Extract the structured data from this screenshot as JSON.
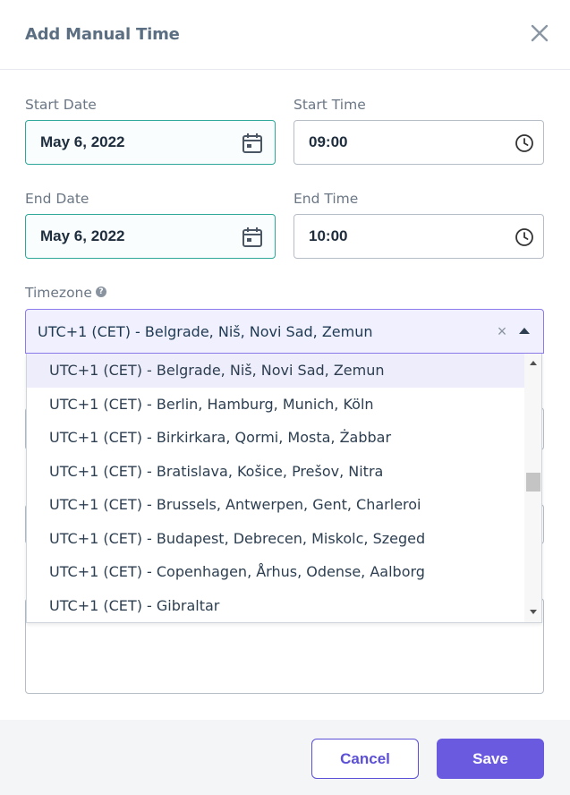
{
  "modal": {
    "title": "Add Manual Time",
    "close_icon": "close-icon"
  },
  "form": {
    "start_date": {
      "label": "Start Date",
      "value": "May 6, 2022",
      "icon": "calendar-icon"
    },
    "start_time": {
      "label": "Start Time",
      "value": "09:00",
      "icon": "clock-icon"
    },
    "end_date": {
      "label": "End Date",
      "value": "May 6, 2022",
      "icon": "calendar-icon"
    },
    "end_time": {
      "label": "End Time",
      "value": "10:00",
      "icon": "clock-icon"
    },
    "timezone": {
      "label": "Timezone",
      "help_icon": "help-icon",
      "value": "UTC+1 (CET) - Belgrade, Niš, Novi Sad, Zemun",
      "clear_glyph": "×",
      "help_glyph": "?"
    }
  },
  "timezone_dropdown": {
    "options": [
      "UTC+1 (CET) - Belgrade, Niš, Novi Sad, Zemun",
      "UTC+1 (CET) - Berlin, Hamburg, Munich, Köln",
      "UTC+1 (CET) - Birkirkara, Qormi, Mosta, Żabbar",
      "UTC+1 (CET) - Bratislava, Košice, Prešov, Nitra",
      "UTC+1 (CET) - Brussels, Antwerpen, Gent, Charleroi",
      "UTC+1 (CET) - Budapest, Debrecen, Miskolc, Szeged",
      "UTC+1 (CET) - Copenhagen, Århus, Odense, Aalborg",
      "UTC+1 (CET) - Gibraltar"
    ],
    "selected_index": 0
  },
  "footer": {
    "cancel_label": "Cancel",
    "save_label": "Save"
  },
  "colors": {
    "accent": "#6a5ae0",
    "date_border": "#2fa89a",
    "selected_bg": "#f1f0ff"
  }
}
